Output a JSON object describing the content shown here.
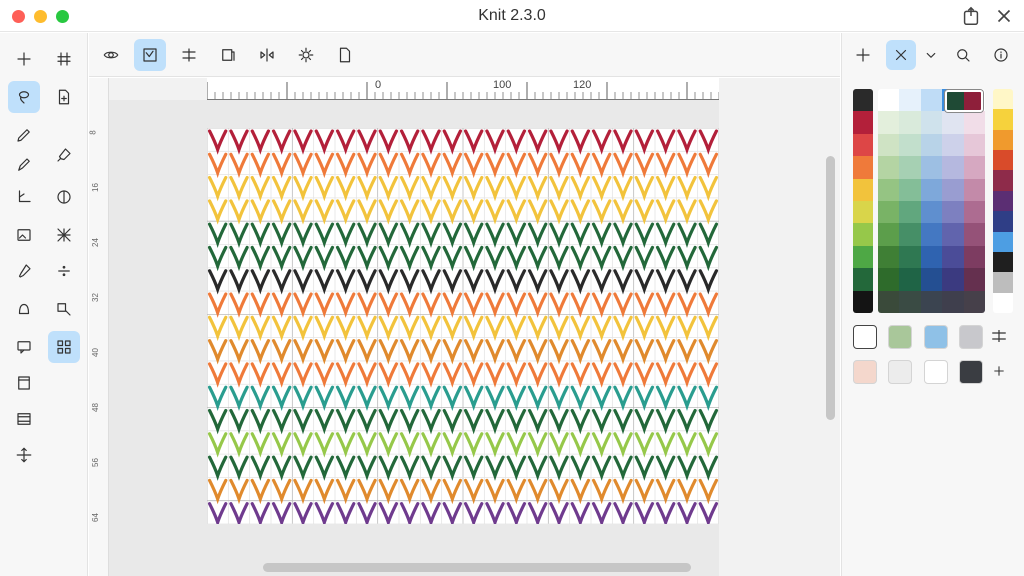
{
  "window": {
    "title": "Knit 2.3.0"
  },
  "left_tools": [
    {
      "name": "add-icon",
      "active": false
    },
    {
      "name": "grid-icon",
      "active": false
    },
    {
      "name": "lasso-icon",
      "active": true
    },
    {
      "name": "add-page-icon",
      "active": false
    },
    {
      "name": "pen-icon",
      "active": false
    },
    {
      "name": "brush-icon",
      "active": false
    },
    {
      "name": "pencil-icon",
      "active": false
    },
    {
      "name": "angle-icon",
      "active": false
    },
    {
      "name": "contrast-icon",
      "active": false
    },
    {
      "name": "picture-icon",
      "active": false
    },
    {
      "name": "pattern-icon",
      "active": false
    },
    {
      "name": "dropper-icon",
      "active": false
    },
    {
      "name": "divide-icon",
      "active": false
    },
    {
      "name": "bell-shape-icon",
      "active": false
    },
    {
      "name": "node-edit-icon",
      "active": false
    },
    {
      "name": "comment-icon",
      "active": false
    },
    {
      "name": "qr-grid-icon",
      "active": true
    },
    {
      "name": "panel-top-icon",
      "active": false
    },
    {
      "name": "film-icon",
      "active": false
    },
    {
      "name": "move-arrows-icon",
      "active": false
    }
  ],
  "canvas_tools": [
    {
      "name": "eye-icon",
      "active": false
    },
    {
      "name": "chart-view-icon",
      "active": true
    },
    {
      "name": "split-icon",
      "active": false
    },
    {
      "name": "layers-icon",
      "active": false
    },
    {
      "name": "flip-icon",
      "active": false
    },
    {
      "name": "settings-cog-icon",
      "active": false
    },
    {
      "name": "document-icon",
      "active": false
    }
  ],
  "ruler": {
    "labels": [
      "0",
      "100",
      "120"
    ],
    "vertical_labels": [
      "8",
      "16",
      "24",
      "32",
      "40",
      "48",
      "56",
      "64"
    ]
  },
  "right_tools": [
    {
      "name": "add-icon",
      "active": false
    },
    {
      "name": "close-icon",
      "active": true
    },
    {
      "name": "chevron-down-icon",
      "active": false
    },
    {
      "name": "zoom-icon",
      "active": false
    },
    {
      "name": "info-icon",
      "active": false
    }
  ],
  "colors": {
    "accent": "#bfe0fb",
    "left_strip": [
      "#2a2a2a",
      "#b3203a",
      "#dd4646",
      "#ef7a3a",
      "#f2c33c",
      "#d9d54a",
      "#96c84a",
      "#4ea845",
      "#23683a",
      "#141414"
    ],
    "right_strip": [
      "#fff7c7",
      "#f6d23c",
      "#f09a2d",
      "#d94b2a",
      "#8e2b4a",
      "#5b2e73",
      "#2f3e86",
      "#4d9ee3",
      "#1f1f1f",
      "#bdbdbd",
      "#ffffff"
    ],
    "grid_columns": [
      [
        "#ffffff",
        "#e3efdc",
        "#cfe3c4",
        "#b4d4a3",
        "#95c483",
        "#79b366",
        "#5c9e4b",
        "#3f7f35",
        "#2e6b2b",
        "#3a4a3a"
      ],
      [
        "#e6f1fb",
        "#d9eadb",
        "#c2dfcc",
        "#a6d0b3",
        "#84be98",
        "#61a77e",
        "#468f67",
        "#2f7852",
        "#1f6446",
        "#3a4b44"
      ],
      [
        "#bfdcf6",
        "#cfe2ec",
        "#b8d3e8",
        "#9dbfe3",
        "#7ea8da",
        "#5f8fcf",
        "#4478c2",
        "#2f63b0",
        "#244f92",
        "#3b4450"
      ],
      [
        "#3b8ee0",
        "#e0e4f1",
        "#cdd1ea",
        "#b5b8df",
        "#999dd1",
        "#7d80c0",
        "#6164ad",
        "#4b4c98",
        "#3b3a80",
        "#3f3f4d"
      ],
      [
        "#ffffff",
        "#f1dde8",
        "#e6c7d8",
        "#d6a8c1",
        "#c38aa9",
        "#ad6c91",
        "#955278",
        "#7d3c61",
        "#65304f",
        "#46404a"
      ]
    ],
    "selected_pair": [
      "#1f4a35",
      "#8e1f3a"
    ],
    "swatches_row1": [
      "#ffffff",
      "#a9c79a",
      "#8fc1e7",
      "#c8c8cc"
    ],
    "swatches_row2": [
      "#f4d7cc",
      "#ececec",
      "#ffffff",
      "#3a3d42"
    ]
  },
  "chart": {
    "stitch_colors": [
      "#b3203a",
      "#dd4646",
      "#ef7a3a",
      "#f2c33c",
      "#96c84a",
      "#23683a",
      "#2a9d8f",
      "#3b8ee0",
      "#6f3b8e",
      "#2a2a2a",
      "#c2567a",
      "#e08a2d"
    ]
  }
}
